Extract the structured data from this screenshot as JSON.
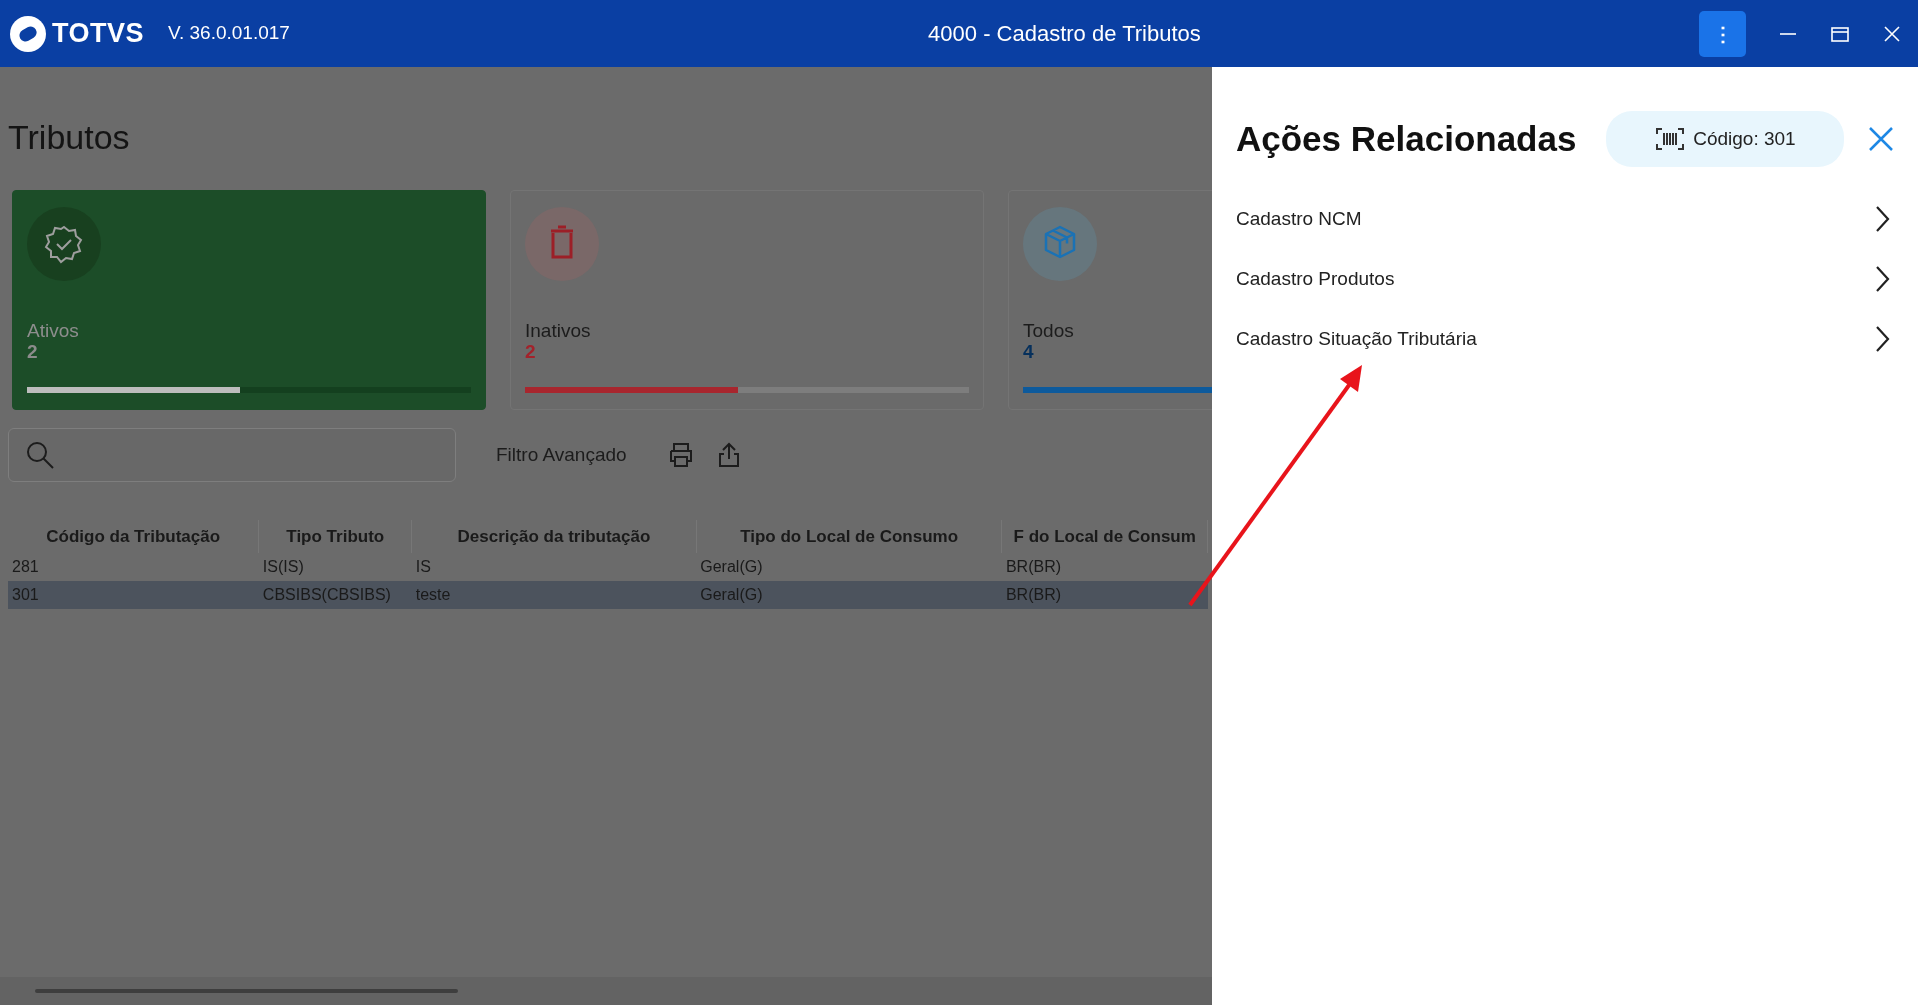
{
  "window": {
    "logo": "TOTVS",
    "version": "V. 36.0.01.017",
    "title": "4000 - Cadastro de Tributos",
    "menu_button": "⋮"
  },
  "page": {
    "title": "Tributos"
  },
  "cards": [
    {
      "kind": "active",
      "label": "Ativos",
      "count": "2",
      "level": 0.48,
      "selected": true
    },
    {
      "kind": "inactive",
      "label": "Inativos",
      "count": "2",
      "level": 0.48,
      "selected": false
    },
    {
      "kind": "all",
      "label": "Todos",
      "count": "4",
      "level": 1,
      "selected": false
    }
  ],
  "toolbar": {
    "filter_link": "Filtro Avançado"
  },
  "table": {
    "columns": [
      "Código da Tributação",
      "Tipo Tributo",
      "Descrição da tributação",
      "Tipo do Local de Consumo",
      "F do Local de Consum"
    ],
    "rows": [
      {
        "cells": [
          "281",
          "IS(IS)",
          "IS",
          "Geral(G)",
          "BR(BR)"
        ],
        "selected": false
      },
      {
        "cells": [
          "301",
          "CBSIBS(CBSIBS)",
          "teste",
          "Geral(G)",
          "BR(BR)"
        ],
        "selected": true
      }
    ]
  },
  "panel": {
    "title": "Ações Relacionadas",
    "chip": "Código: 301",
    "actions": [
      {
        "label": "Cadastro NCM"
      },
      {
        "label": "Cadastro Produtos"
      },
      {
        "label": "Cadastro Situação Tributária"
      }
    ]
  }
}
